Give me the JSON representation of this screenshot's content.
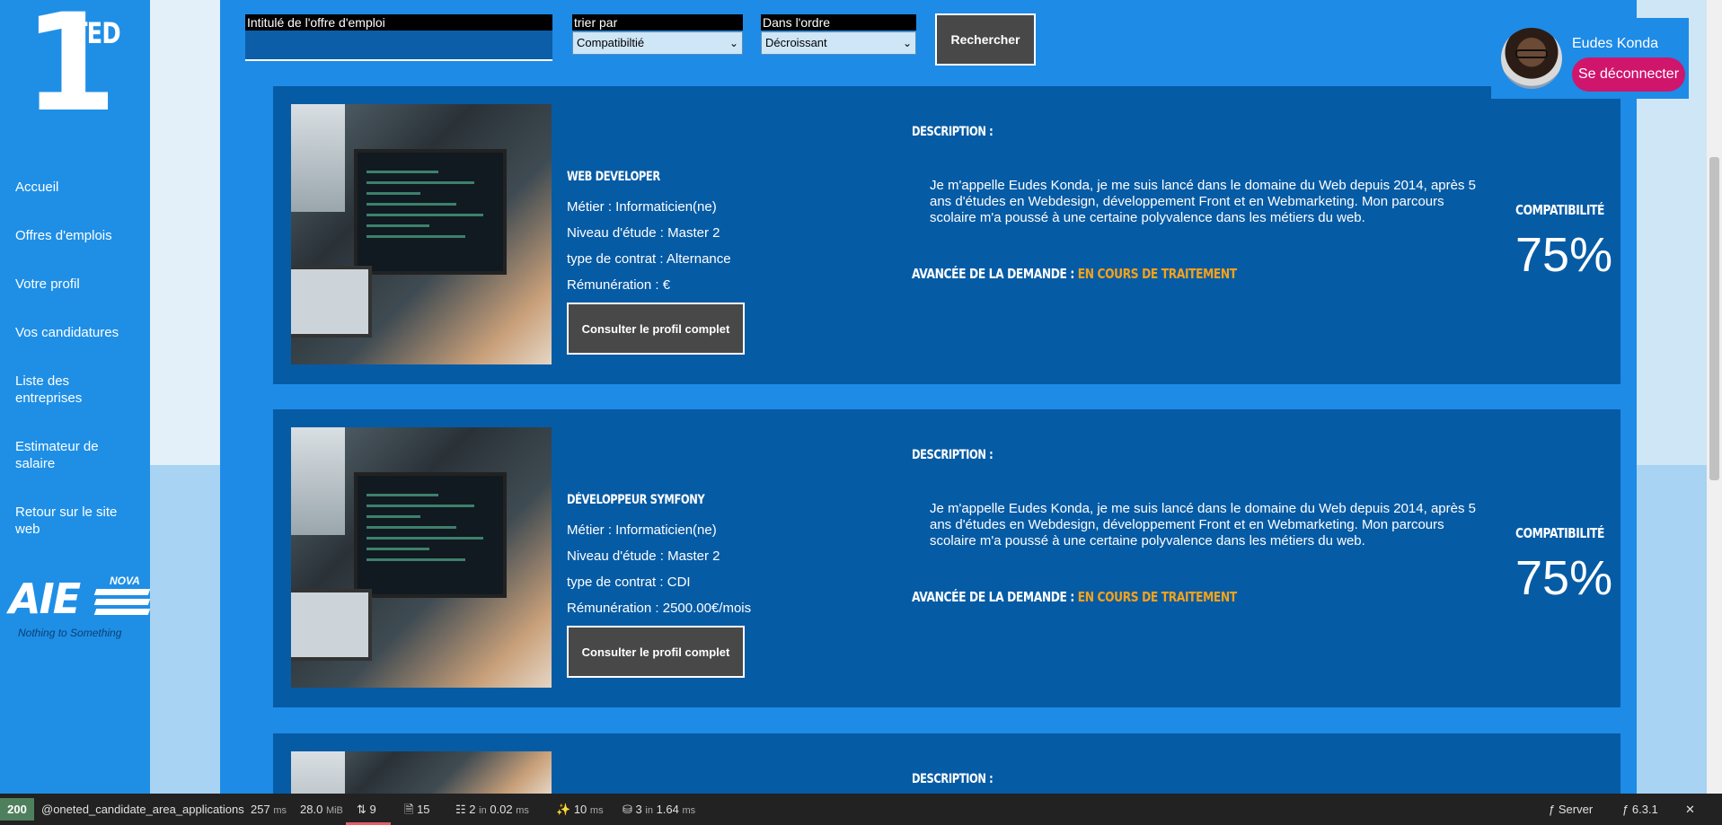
{
  "sidebar": {
    "logo_digit": "1",
    "logo_text": "TED",
    "nav": [
      {
        "label": "Accueil"
      },
      {
        "label": "Offres d'emplois"
      },
      {
        "label": "Votre profil"
      },
      {
        "label": "Vos candidatures"
      },
      {
        "label": "Liste des entreprises"
      },
      {
        "label": "Estimateur de salaire"
      },
      {
        "label": "Retour sur le site web"
      }
    ],
    "partner_logo": {
      "name": "AIE",
      "badge": "NOVA",
      "tagline": "Nothing to Something"
    }
  },
  "search": {
    "keyword_label": "Intitulé de l'offre d'emploi",
    "keyword_value": "",
    "sort_label": "trier par",
    "sort_value": "Compatibiltié",
    "order_label": "Dans l'ordre",
    "order_value": "Décroissant",
    "submit_label": "Rechercher"
  },
  "user": {
    "name": "Eudes Konda",
    "logout_label": "Se déconnecter"
  },
  "applications": [
    {
      "title": "WEB DEVELOPER",
      "metier": "Métier : Informaticien(ne)",
      "niveau": "Niveau d'étude : Master 2",
      "contrat": "type de contrat : Alternance",
      "remuneration": "Rémunération : €",
      "button_label": "Consulter le profil complet",
      "description_label": "DESCRIPTION :",
      "description": "Je m'appelle Eudes Konda, je me suis lancé dans le domaine du Web depuis 2014, après 5 ans d'études en Webdesign, développement Front et en Webmarketing. Mon parcours scolaire m'a poussé à une certaine polyvalence dans les métiers du web.",
      "progress_label": "AVANCÉE DE LA DEMANDE : ",
      "progress_status": "EN COURS DE TRAITEMENT",
      "compat_label": "COMPATIBILITÉ",
      "compat_value": "75%"
    },
    {
      "title": "DÉVELOPPEUR SYMFONY",
      "metier": "Métier : Informaticien(ne)",
      "niveau": "Niveau d'étude : Master 2",
      "contrat": "type de contrat : CDI",
      "remuneration": "Rémunération : 2500.00€/mois",
      "button_label": "Consulter le profil complet",
      "description_label": "DESCRIPTION :",
      "description": "Je m'appelle Eudes Konda, je me suis lancé dans le domaine du Web depuis 2014, après 5 ans d'études en Webdesign, développement Front et en Webmarketing. Mon parcours scolaire m'a poussé à une certaine polyvalence dans les métiers du web.",
      "progress_label": "AVANCÉE DE LA DEMANDE : ",
      "progress_status": "EN COURS DE TRAITEMENT",
      "compat_label": "COMPATIBILITÉ",
      "compat_value": "75%"
    },
    {
      "description_label": "DESCRIPTION :"
    }
  ],
  "toolbar": {
    "status_code": "200",
    "route": "@oneted_candidate_area_applications",
    "time_value": "257",
    "time_unit": "ms",
    "memory_value": "28.0",
    "memory_unit": "MiB",
    "requests_count": "9",
    "forms_count": "15",
    "cache_value": "2",
    "cache_in": "in",
    "cache_time": "0.02",
    "cache_unit": "ms",
    "twig_value": "10",
    "twig_unit": "ms",
    "db_value": "3",
    "db_in": "in",
    "db_time": "1.64",
    "db_unit": "ms",
    "server_label": "Server",
    "version": "6.3.1"
  },
  "colors": {
    "primary": "#1e8be6",
    "card": "#065ba5",
    "accent": "#d0156d",
    "status": "#f6a21a"
  }
}
